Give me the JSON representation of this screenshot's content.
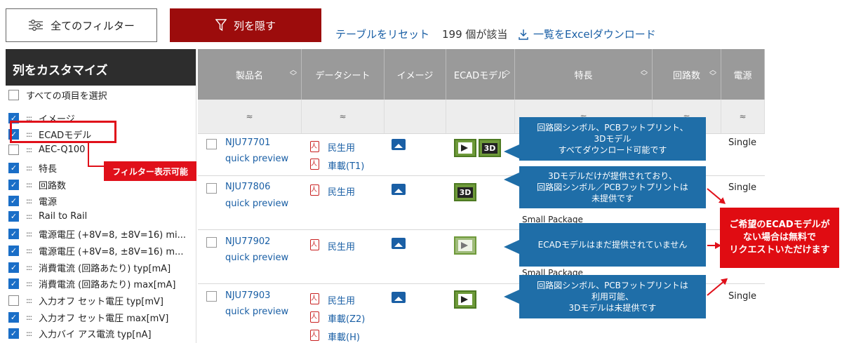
{
  "toolbar": {
    "all_filters_label": "全てのフィルター",
    "hide_columns_label": "列を隠す",
    "reset_table_label": "テーブルをリセット",
    "hit_count": "199 個が該当",
    "excel_download_label": "一覧をExcelダウンロード"
  },
  "sidebar": {
    "title": "列をカスタマイズ",
    "select_all": "すべての項目を選択",
    "items": [
      {
        "label": "イメージ",
        "checked": true
      },
      {
        "label": "ECADモデル",
        "checked": true
      },
      {
        "label": "AEC-Q100",
        "checked": false
      },
      {
        "label": "特長",
        "checked": true
      },
      {
        "label": "回路数",
        "checked": true
      },
      {
        "label": "電源",
        "checked": true
      },
      {
        "label": "Rail to Rail",
        "checked": true
      },
      {
        "label": "電源電圧 (+8V=8, ±8V=16) mi...",
        "checked": true
      },
      {
        "label": "電源電圧 (+8V=8, ±8V=16) m...",
        "checked": true
      },
      {
        "label": "消費電流 (回路あたり) typ[mA]",
        "checked": true
      },
      {
        "label": "消費電流 (回路あたり) max[mA]",
        "checked": true
      },
      {
        "label": "入力オフ セット電圧 typ[mV]",
        "checked": true
      },
      {
        "label": "入力オフ セット電圧 max[mV]",
        "checked": true
      },
      {
        "label": "入力バイ アス電流 typ[nA]",
        "checked": true
      }
    ],
    "filter_callout": "フィルター表示可能"
  },
  "table": {
    "headers": [
      "製品名",
      "データシート",
      "イメージ",
      "ECADモデル",
      "特長",
      "回路数",
      "電源"
    ],
    "filter_icon": "≈",
    "quick_preview": "quick preview",
    "rows": [
      {
        "part": "NJU77701",
        "datasheets": [
          "民生用",
          "車載(T1)"
        ],
        "power": "Single",
        "feature": ""
      },
      {
        "part": "NJU77806",
        "datasheets": [
          "民生用"
        ],
        "power": "Single",
        "feature": "Small Package"
      },
      {
        "part": "NJU77902",
        "datasheets": [
          "民生用"
        ],
        "power": "",
        "feature": "Small Package"
      },
      {
        "part": "NJU77903",
        "datasheets": [
          "民生用",
          "車載(Z2)",
          "車載(H)"
        ],
        "power": "Single",
        "feature": ""
      }
    ],
    "ecad_3d_label": "3D"
  },
  "callouts": {
    "row1_line1": "回路図シンボル、PCBフットプリント、",
    "row1_line2": "3Dモデル",
    "row1_line3": "すべてダウンロード可能です",
    "row2_line1": "3Dモデルだけが提供されており、",
    "row2_line2": "回路図シンボル／PCBフットプリントは",
    "row2_line3": "未提供です",
    "row3_line1": "ECADモデルはまだ提供されていません",
    "row4_line1": "回路図シンボル、PCBフットプリントは",
    "row4_line2": "利用可能、",
    "row4_line3": "3Dモデルは未提供です",
    "request_line1": "ご希望のECADモデルが",
    "request_line2": "ない場合は無料で",
    "request_line3": "リクエストいただけます"
  },
  "colors": {
    "hide_button": "#9c0c0c",
    "link": "#1a5fa5",
    "callout_blue": "#1f6ea8",
    "highlight_red": "#e0101a"
  }
}
